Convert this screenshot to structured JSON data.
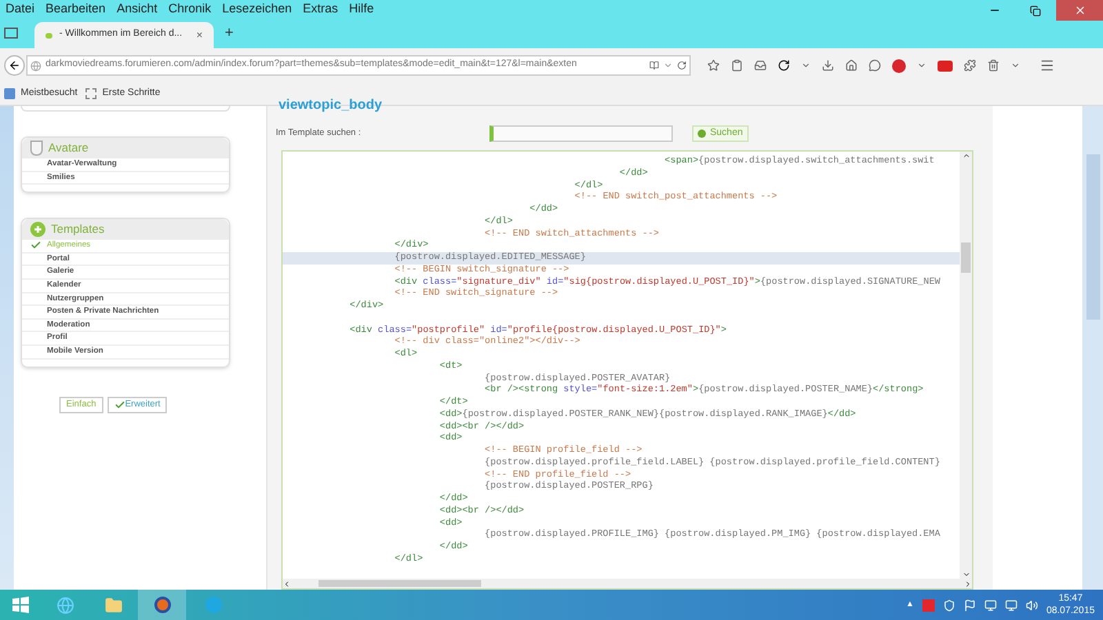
{
  "menu_bar": [
    "Datei",
    "Bearbeiten",
    "Ansicht",
    "Chronik",
    "Lesezeichen",
    "Extras",
    "Hilfe"
  ],
  "tabs": [
    {
      "title": "- Willkommen im Bereich d...",
      "close": "×",
      "selected": true
    }
  ],
  "new_tab": "+",
  "address_bar": {
    "url": "darkmoviedreams.forumieren.com/admin/index.forum?part=themes&sub=templates&mode=edit_main&t=127&l=main&exten"
  },
  "bookmarks": [
    "Meistbesucht",
    "Erste Schritte"
  ],
  "sidebar": {
    "groups": [
      {
        "title": "Avatare",
        "items": [
          {
            "label": "Avatar-Verwaltung",
            "selected": false
          },
          {
            "label": "Smilies",
            "selected": false
          }
        ]
      },
      {
        "title": "Templates",
        "items": [
          {
            "label": "Allgemeines",
            "selected": true
          },
          {
            "label": "Portal",
            "selected": false
          },
          {
            "label": "Galerie",
            "selected": false
          },
          {
            "label": "Kalender",
            "selected": false
          },
          {
            "label": "Nutzergruppen",
            "selected": false
          },
          {
            "label": "Posten & Private Nachrichten",
            "selected": false
          },
          {
            "label": "Moderation",
            "selected": false
          },
          {
            "label": "Profil",
            "selected": false
          },
          {
            "label": "Mobile Version",
            "selected": false
          }
        ]
      }
    ],
    "mode_buttons": [
      {
        "label": "Einfach",
        "selected": false
      },
      {
        "label": "Erweitert",
        "selected": true
      }
    ]
  },
  "editor": {
    "title": "viewtopic_body",
    "search_label": "Im Template suchen :",
    "search_button": "Suchen",
    "code_lines": [
      {
        "highlighted": false,
        "tokens": [
          {
            "kind": "tag",
            "text": "\t\t\t\t\t\t\t\t<span>"
          },
          {
            "kind": "text",
            "text": "{postrow.displayed.switch_attachments.swit"
          }
        ]
      },
      {
        "highlighted": false,
        "tokens": [
          {
            "kind": "tag",
            "text": "\t\t\t\t\t\t\t</dd>"
          }
        ]
      },
      {
        "highlighted": false,
        "tokens": [
          {
            "kind": "tag",
            "text": "\t\t\t\t\t\t</dl>"
          }
        ]
      },
      {
        "highlighted": false,
        "tokens": [
          {
            "kind": "comment",
            "text": "\t\t\t\t\t\t<!-- END switch_post_attachments -->"
          }
        ]
      },
      {
        "highlighted": false,
        "tokens": [
          {
            "kind": "tag",
            "text": "\t\t\t\t\t</dd>"
          }
        ]
      },
      {
        "highlighted": false,
        "tokens": [
          {
            "kind": "tag",
            "text": "\t\t\t\t</dl>"
          }
        ]
      },
      {
        "highlighted": false,
        "tokens": [
          {
            "kind": "comment",
            "text": "\t\t\t\t<!-- END switch_attachments -->"
          }
        ]
      },
      {
        "highlighted": false,
        "tokens": [
          {
            "kind": "tag",
            "text": "\t\t</div>"
          }
        ]
      },
      {
        "highlighted": true,
        "tokens": [
          {
            "kind": "text",
            "text": "\t\t{postrow.displayed.EDITED_MESSAGE}"
          }
        ]
      },
      {
        "highlighted": false,
        "tokens": [
          {
            "kind": "comment",
            "text": "\t\t<!-- BEGIN switch_signature -->"
          }
        ]
      },
      {
        "highlighted": false,
        "tokens": [
          {
            "kind": "tag",
            "text": "\t\t<div "
          },
          {
            "kind": "attr",
            "text": "class="
          },
          {
            "kind": "str",
            "text": "\"signature_div\""
          },
          {
            "kind": "attr",
            "text": " id="
          },
          {
            "kind": "str",
            "text": "\"sig{postrow.displayed.U_POST_ID}\""
          },
          {
            "kind": "tag",
            "text": ">"
          },
          {
            "kind": "text",
            "text": "{postrow.displayed.SIGNATURE_NEW"
          }
        ]
      },
      {
        "highlighted": false,
        "tokens": [
          {
            "kind": "comment",
            "text": "\t\t<!-- END switch_signature -->"
          }
        ]
      },
      {
        "highlighted": false,
        "tokens": [
          {
            "kind": "tag",
            "text": "\t</div>"
          }
        ]
      },
      {
        "highlighted": false
      },
      {
        "highlighted": false,
        "tokens": [
          {
            "kind": "tag",
            "text": "\t<div "
          },
          {
            "kind": "attr",
            "text": "class="
          },
          {
            "kind": "str",
            "text": "\"postprofile\""
          },
          {
            "kind": "attr",
            "text": " id="
          },
          {
            "kind": "str",
            "text": "\"profile{postrow.displayed.U_POST_ID}\""
          },
          {
            "kind": "tag",
            "text": ">"
          }
        ]
      },
      {
        "highlighted": false,
        "tokens": [
          {
            "kind": "comment",
            "text": "\t\t<!-- div class=\"online2\"></div-->"
          }
        ]
      },
      {
        "highlighted": false,
        "tokens": [
          {
            "kind": "tag",
            "text": "\t\t<dl>"
          }
        ]
      },
      {
        "highlighted": false,
        "tokens": [
          {
            "kind": "tag",
            "text": "\t\t\t<dt>"
          }
        ]
      },
      {
        "highlighted": false,
        "tokens": [
          {
            "kind": "text",
            "text": "\t\t\t\t{postrow.displayed.POSTER_AVATAR}"
          }
        ]
      },
      {
        "highlighted": false,
        "tokens": [
          {
            "kind": "tag",
            "text": "\t\t\t\t<br /><strong "
          },
          {
            "kind": "attr",
            "text": "style="
          },
          {
            "kind": "str",
            "text": "\"font-size:1.2em\""
          },
          {
            "kind": "tag",
            "text": ">"
          },
          {
            "kind": "text",
            "text": "{postrow.displayed.POSTER_NAME}"
          },
          {
            "kind": "tag",
            "text": "</strong>"
          }
        ]
      },
      {
        "highlighted": false,
        "tokens": [
          {
            "kind": "tag",
            "text": "\t\t\t</dt>"
          }
        ]
      },
      {
        "highlighted": false,
        "tokens": [
          {
            "kind": "tag",
            "text": "\t\t\t<dd>"
          },
          {
            "kind": "text",
            "text": "{postrow.displayed.POSTER_RANK_NEW}{postrow.displayed.RANK_IMAGE}"
          },
          {
            "kind": "tag",
            "text": "</dd>"
          }
        ]
      },
      {
        "highlighted": false,
        "tokens": [
          {
            "kind": "tag",
            "text": "\t\t\t<dd><br /></dd>"
          }
        ]
      },
      {
        "highlighted": false,
        "tokens": [
          {
            "kind": "tag",
            "text": "\t\t\t<dd>"
          }
        ]
      },
      {
        "highlighted": false,
        "tokens": [
          {
            "kind": "comment",
            "text": "\t\t\t\t<!-- BEGIN profile_field -->"
          }
        ]
      },
      {
        "highlighted": false,
        "tokens": [
          {
            "kind": "text",
            "text": "\t\t\t\t{postrow.displayed.profile_field.LABEL} {postrow.displayed.profile_field.CONTENT}"
          }
        ]
      },
      {
        "highlighted": false,
        "tokens": [
          {
            "kind": "comment",
            "text": "\t\t\t\t<!-- END profile_field -->"
          }
        ]
      },
      {
        "highlighted": false,
        "tokens": [
          {
            "kind": "text",
            "text": "\t\t\t\t{postrow.displayed.POSTER_RPG}"
          }
        ]
      },
      {
        "highlighted": false,
        "tokens": [
          {
            "kind": "tag",
            "text": "\t\t\t</dd>"
          }
        ]
      },
      {
        "highlighted": false,
        "tokens": [
          {
            "kind": "tag",
            "text": "\t\t\t<dd><br /></dd>"
          }
        ]
      },
      {
        "highlighted": false,
        "tokens": [
          {
            "kind": "tag",
            "text": "\t\t\t<dd>"
          }
        ]
      },
      {
        "highlighted": false,
        "tokens": [
          {
            "kind": "text",
            "text": "\t\t\t\t{postrow.displayed.PROFILE_IMG} {postrow.displayed.PM_IMG} {postrow.displayed.EMA"
          }
        ]
      },
      {
        "highlighted": false,
        "tokens": [
          {
            "kind": "tag",
            "text": "\t\t\t</dd>"
          }
        ]
      },
      {
        "highlighted": false,
        "tokens": [
          {
            "kind": "tag",
            "text": "\t\t</dl>"
          }
        ]
      }
    ]
  },
  "taskbar": {
    "clock": {
      "time": "15:47",
      "date": "08.07.2015"
    },
    "tray_arrow": "▲"
  }
}
